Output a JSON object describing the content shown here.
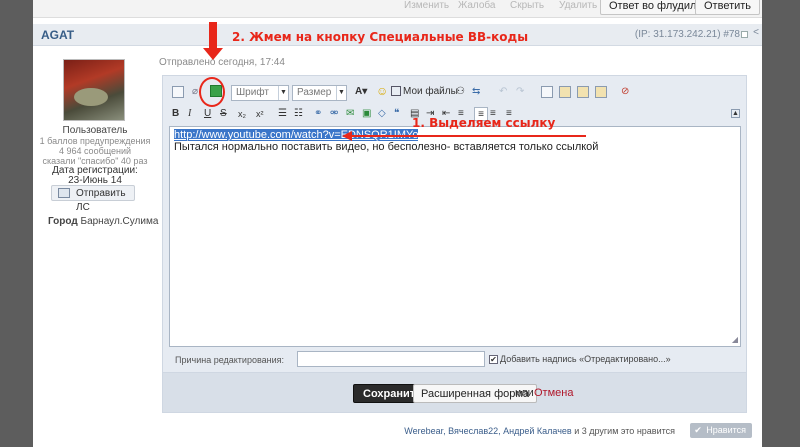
{
  "top_bar": {
    "links": [
      "Изменить",
      "Жалоба",
      "Скрыть",
      "Удалить"
    ],
    "reply_flood_button": "Ответ во флудильне",
    "reply_button": "Ответить"
  },
  "post": {
    "author": "AGAT",
    "ip": "(IP: 31.173.242.21)",
    "number": "#78",
    "sent": "Отправлено сегодня, 17:44"
  },
  "sidebar": {
    "role": "Пользователь",
    "warnings": "1 баллов предупреждения",
    "messages": "4 964 сообщений",
    "thanks": "сказали \"спасибо\" 40 раз",
    "reg_label": "Дата регистрации:",
    "reg_date": "23-Июнь 14",
    "send_pm": "Отправить ЛС",
    "city_label": "Город",
    "city_value": "Барнаул.Сулима"
  },
  "editor": {
    "font_select": "Шрифт",
    "size_select": "Размер",
    "my_files": "Мои файлы",
    "text_line1": "http://www.youtube.com/watch?v=EDNSQR1IMYo",
    "text_line2": "Пытался нормально поставить видео, но бесполезно- вставляется только ссылкой",
    "toolbar2_bold": "B",
    "toolbar2_italic": "I",
    "toolbar2_underline": "U",
    "toolbar2_strike": "S",
    "toolbar2_sub": "x₂",
    "toolbar2_sup": "x²",
    "reason_label": "Причина редактирования:",
    "reason_value": "",
    "edited_note_label": "Добавить надпись «Отредактировано...»"
  },
  "actions": {
    "save": "Сохранить",
    "advanced": "Расширенная форма",
    "or": "или",
    "cancel": "Отмена"
  },
  "likes": {
    "names": "Werebear, Вячеслав22, Андрей Калачев",
    "rest": " и 3 другим это нравится",
    "like_button": "Нравится"
  },
  "annotations": {
    "step2": "2. Жмем на кнопку Специальные BB-коды",
    "step1": "1. Выделяем ссылку"
  },
  "colors": {
    "annotation_red": "#e8271a",
    "selection_blue": "#3b76c9",
    "cancel_red": "#b0172a"
  }
}
